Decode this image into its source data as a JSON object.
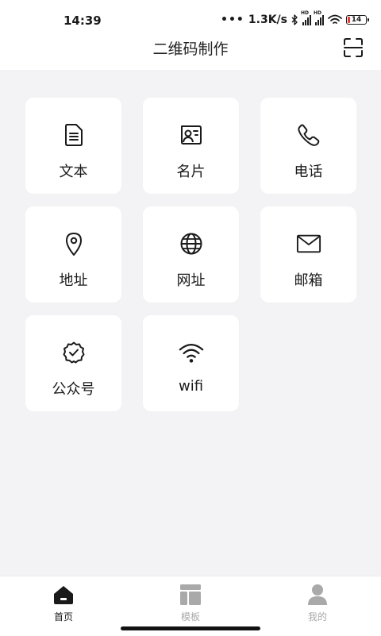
{
  "status": {
    "time": "14:39",
    "dots": "•••",
    "speed": "1.3K/s",
    "hd": "HD",
    "battery": "14",
    "icons": [
      "bluetooth-icon",
      "signal-icon",
      "wifi-icon",
      "battery-icon"
    ]
  },
  "header": {
    "title": "二维码制作",
    "action_icon": "scan-icon"
  },
  "grid": {
    "items": [
      {
        "label": "文本",
        "icon": "document-icon"
      },
      {
        "label": "名片",
        "icon": "business-card-icon"
      },
      {
        "label": "电话",
        "icon": "phone-icon"
      },
      {
        "label": "地址",
        "icon": "location-pin-icon"
      },
      {
        "label": "网址",
        "icon": "globe-icon"
      },
      {
        "label": "邮箱",
        "icon": "mail-icon"
      },
      {
        "label": "公众号",
        "icon": "verified-badge-icon"
      },
      {
        "label": "wifi",
        "icon": "wifi-icon"
      }
    ]
  },
  "tabbar": {
    "items": [
      {
        "label": "首页",
        "icon": "home-icon",
        "active": true
      },
      {
        "label": "模板",
        "icon": "template-icon",
        "active": false
      },
      {
        "label": "我的",
        "icon": "profile-icon",
        "active": false
      }
    ],
    "active_color": "#1a1a1a",
    "inactive_color": "#a9a9a9"
  }
}
